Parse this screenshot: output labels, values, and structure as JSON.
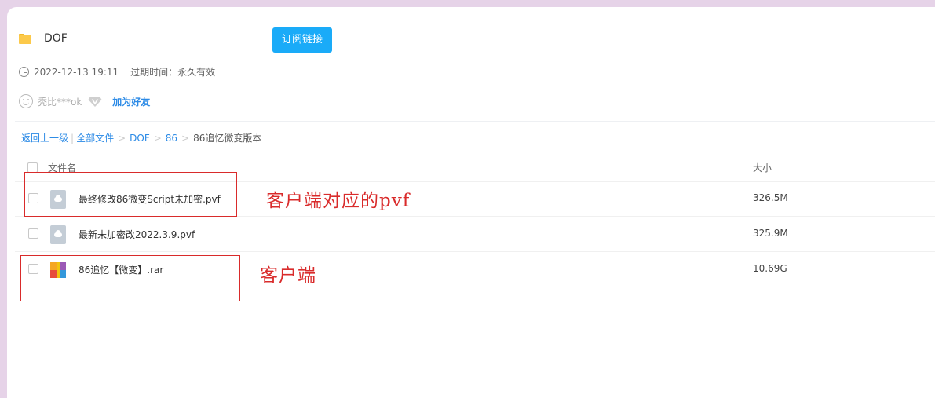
{
  "share": {
    "folder_name": "DOF",
    "subscribe_label": "订阅链接",
    "date": "2022-12-13 19:11",
    "expire_label": "过期时间：",
    "expire_value": "永久有效",
    "user_name": "秃比***ok",
    "add_friend_label": "加为好友"
  },
  "breadcrumb": {
    "back": "返回上一级",
    "pipe": "|",
    "all_files": "全部文件",
    "sep": ">",
    "items": [
      "DOF",
      "86"
    ],
    "current": "86追忆微变版本"
  },
  "table": {
    "col_name": "文件名",
    "col_size": "大小",
    "rows": [
      {
        "name": "最终修改86微变Script未加密.pvf",
        "size": "326.5M",
        "icon": "cloud-doc-icon"
      },
      {
        "name": "最新未加密改2022.3.9.pvf",
        "size": "325.9M",
        "icon": "cloud-doc-icon"
      },
      {
        "name": "86追忆【微变】.rar",
        "size": "10.69G",
        "icon": "rar-archive-icon"
      }
    ]
  },
  "annotations": {
    "first": "客户端对应的pvf",
    "second": "客户端",
    "color": "#d92b2b"
  },
  "colors": {
    "accent": "#1aabf8",
    "link": "#2b8ae6",
    "background": "#e6d3e8"
  }
}
